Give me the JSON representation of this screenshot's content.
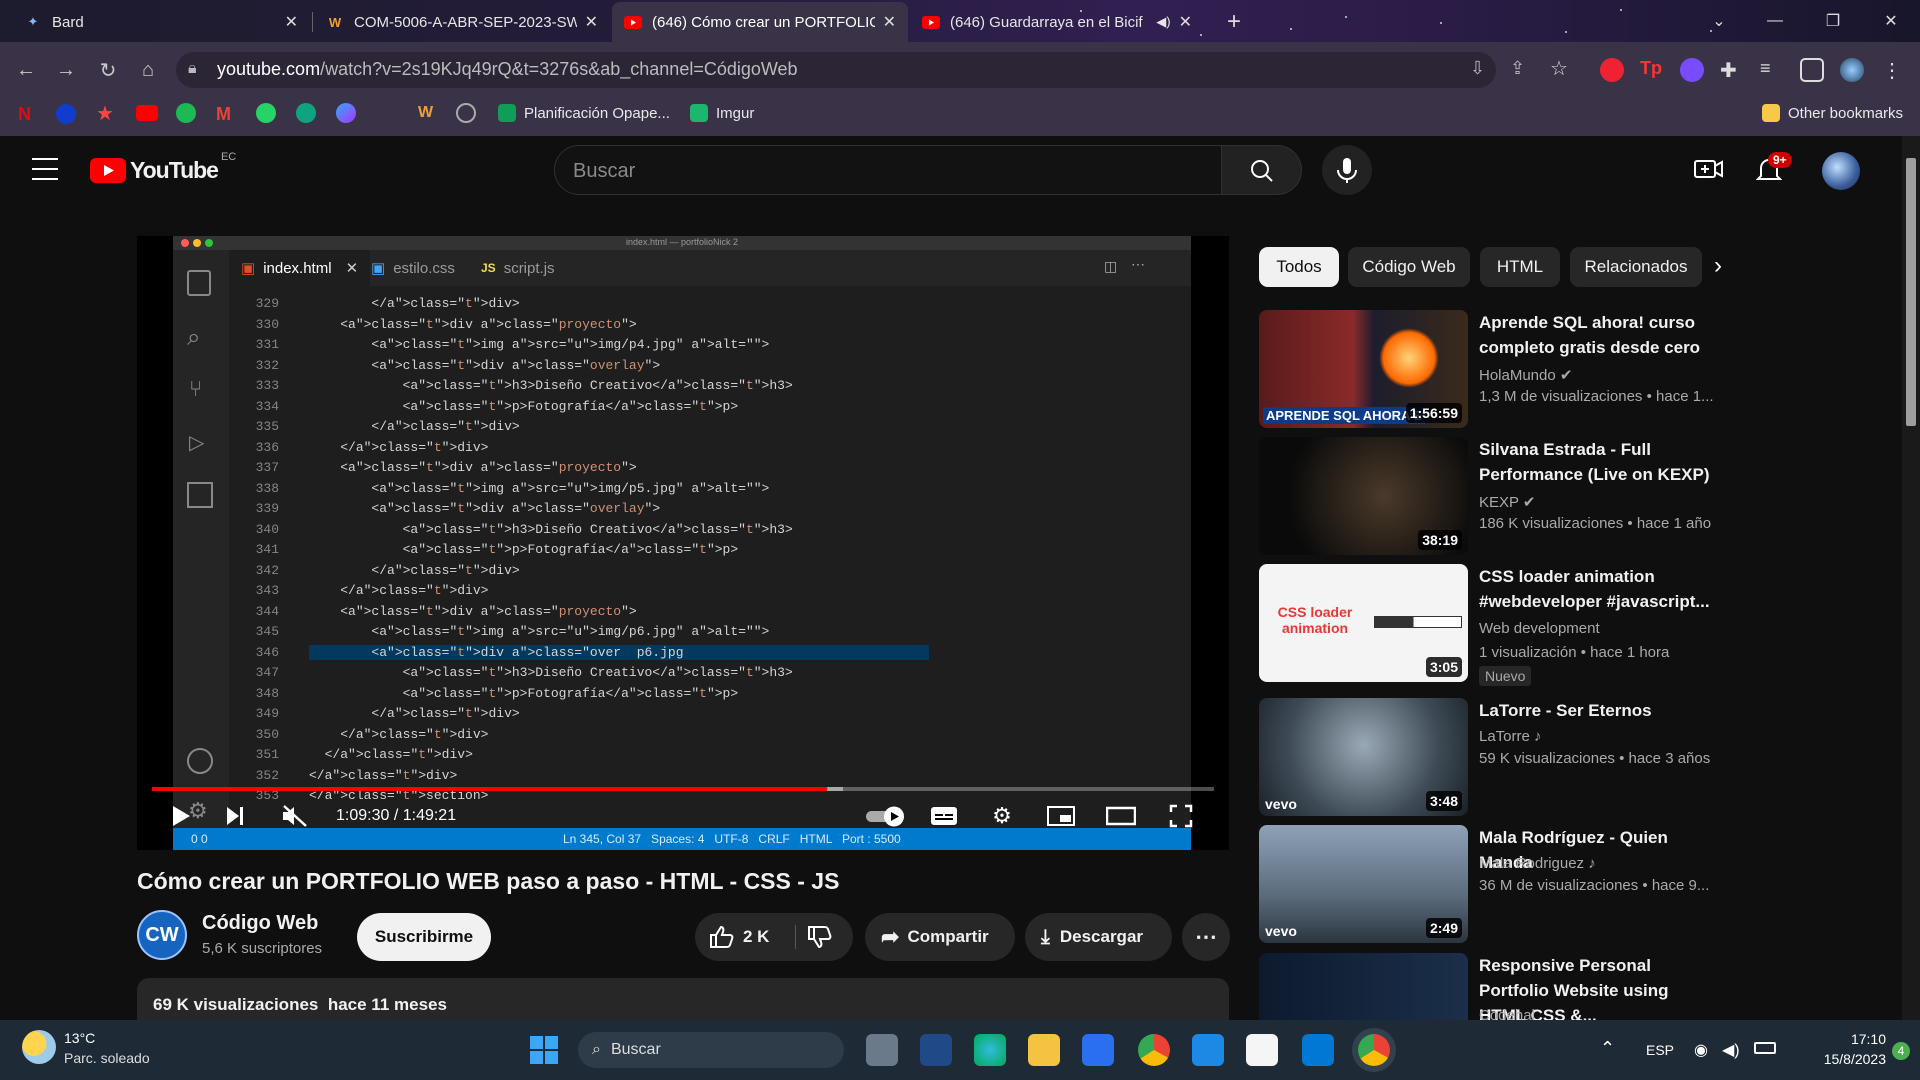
{
  "browser": {
    "tabs": [
      {
        "label": "Bard",
        "icon": "bard-icon"
      },
      {
        "label": "COM-5006-A-ABR-SEP-2023-SW",
        "icon": "moodle-icon"
      },
      {
        "label": "(646) Cómo crear un PORTFOLIO",
        "icon": "youtube-icon"
      },
      {
        "label": "(646) Guardarraya en el Bicif",
        "icon": "youtube-icon"
      }
    ],
    "new_tab": "+",
    "url_domain": "youtube.com",
    "url_path": "/watch?v=2s19KJq49rQ&t=3276s&ab_channel=CódigoWeb",
    "bookmarks": [
      "Planificación Opape...",
      "Imgur"
    ],
    "other_bookmarks": "Other bookmarks"
  },
  "youtube": {
    "logo_text": "YouTube",
    "country": "EC",
    "search_placeholder": "Buscar",
    "notifications": "9+",
    "chips": [
      "Todos",
      "Código Web",
      "HTML",
      "Relacionados"
    ],
    "video": {
      "title": "Cómo crear un PORTFOLIO WEB paso a paso - HTML - CSS - JS",
      "time": "1:09:30 / 1:49:21",
      "progress_fraction": 0.636,
      "channel": "Código Web",
      "channel_initials": "CW",
      "subscribers": "5,6 K suscriptores",
      "subscribe_label": "Suscribirme",
      "likes": "2 K",
      "share_label": "Compartir",
      "download_label": "Descargar",
      "views": "69 K visualizaciones",
      "age": "hace 11 meses"
    },
    "recommendations": [
      {
        "title": "Aprende SQL ahora! curso completo gratis desde cero",
        "channel": "HolaMundo",
        "meta": "1,3 M de visualizaciones  •  hace 1...",
        "duration": "1:56:59",
        "thumb_text": "APRENDE SQL AHORA E"
      },
      {
        "title": "Silvana Estrada - Full Performance (Live on KEXP)",
        "channel": "KEXP",
        "meta": "186 K visualizaciones  •  hace 1 año",
        "duration": "38:19"
      },
      {
        "title": "CSS loader animation #webdeveloper #javascript...",
        "channel": "Web development",
        "meta": "1 visualización  •  hace 1 hora",
        "duration": "3:05",
        "badge": "Nuevo",
        "thumb_text": "CSS loader animation"
      },
      {
        "title": "LaTorre - Ser Eternos",
        "channel": "LaTorre",
        "meta": "59 K visualizaciones  •  hace 3 años",
        "duration": "3:48",
        "thumb_text": "vevo"
      },
      {
        "title": "Mala Rodríguez - Quien Manda",
        "channel": "Mala Rodriguez",
        "meta": "36 M de visualizaciones  •  hace 9...",
        "duration": "2:49",
        "thumb_text": "vevo"
      },
      {
        "title": "Responsive Personal Portfolio Website using HTML CSS &...",
        "channel": "Codehal",
        "meta": ""
      }
    ]
  },
  "editor": {
    "window_title": "index.html — portfolioNick 2",
    "tabs": [
      "index.html",
      "estilo.css",
      "script.js"
    ],
    "status": "Ln 345, Col 37   Spaces: 4   UTF-8   CRLF   HTML   Port : 5500",
    "status_left": "0  0",
    "lines": [
      {
        "n": "329",
        "c": "        </div>"
      },
      {
        "n": "330",
        "c": "    <div class=\"proyecto\">"
      },
      {
        "n": "331",
        "c": "        <img src=\"img/p4.jpg\" alt=\"\">"
      },
      {
        "n": "332",
        "c": "        <div class=\"overlay\">"
      },
      {
        "n": "333",
        "c": "            <h3>Diseño Creativo</h3>"
      },
      {
        "n": "334",
        "c": "            <p>Fotografía</p>"
      },
      {
        "n": "335",
        "c": "        </div>"
      },
      {
        "n": "336",
        "c": "    </div>"
      },
      {
        "n": "337",
        "c": "    <div class=\"proyecto\">"
      },
      {
        "n": "338",
        "c": "        <img src=\"img/p5.jpg\" alt=\"\">"
      },
      {
        "n": "339",
        "c": "        <div class=\"overlay\">"
      },
      {
        "n": "340",
        "c": "            <h3>Diseño Creativo</h3>"
      },
      {
        "n": "341",
        "c": "            <p>Fotografía</p>"
      },
      {
        "n": "342",
        "c": "        </div>"
      },
      {
        "n": "343",
        "c": "    </div>"
      },
      {
        "n": "344",
        "c": "    <div class=\"proyecto\">"
      },
      {
        "n": "345",
        "c": "        <img src=\"img/p6.jpg\" alt=\"\">"
      },
      {
        "n": "346",
        "c": "        <div class=\"over  p6.jpg"
      },
      {
        "n": "347",
        "c": "            <h3>Diseño Creativo</h3>"
      },
      {
        "n": "348",
        "c": "            <p>Fotografía</p>"
      },
      {
        "n": "349",
        "c": "        </div>"
      },
      {
        "n": "350",
        "c": "    </div>"
      },
      {
        "n": "351",
        "c": "  </div>"
      },
      {
        "n": "352",
        "c": "</div>"
      },
      {
        "n": "353",
        "c": "</section>"
      }
    ]
  },
  "taskbar": {
    "weather_temp": "13°C",
    "weather_desc": "Parc. soleado",
    "search_label": "Buscar",
    "lang": "ESP",
    "time": "17:10",
    "date": "15/8/2023",
    "badge": "4"
  },
  "colors": {
    "accent_red": "#ff0000",
    "vscode_blue": "#007acc",
    "yt_bg": "#0f0f0f"
  }
}
